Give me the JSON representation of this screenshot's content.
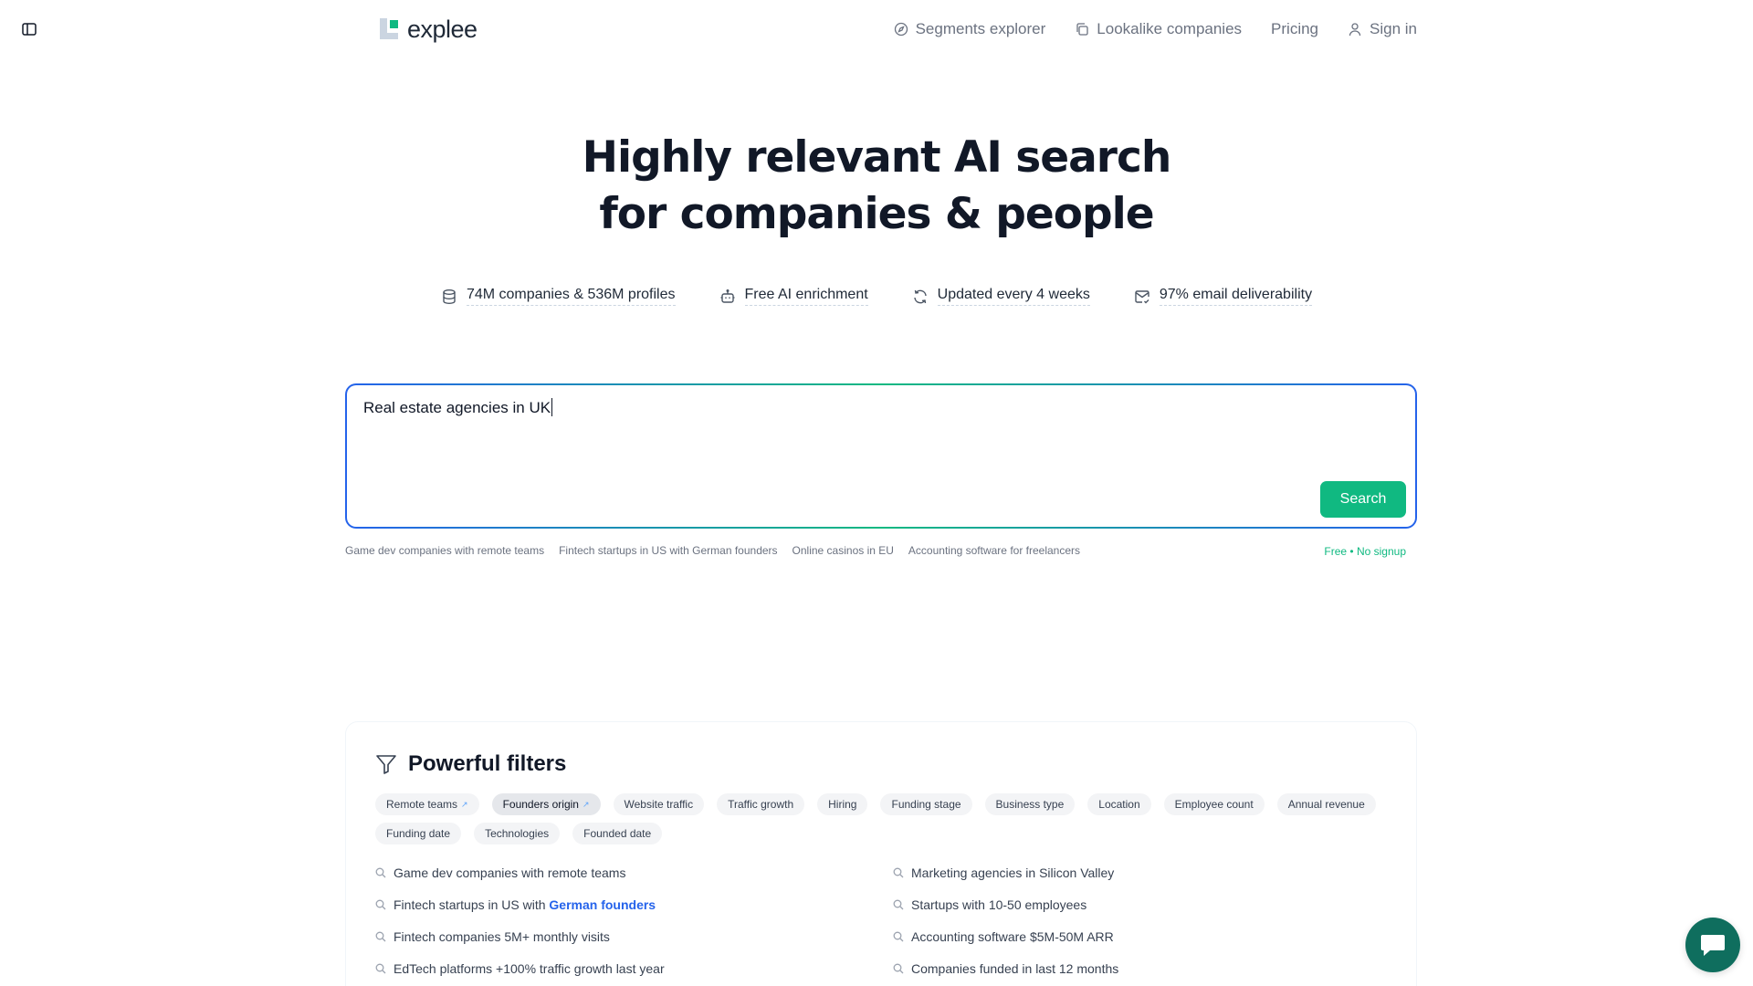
{
  "header": {
    "logo_text": "explee",
    "nav": [
      {
        "label": "Segments explorer",
        "icon": "compass-icon"
      },
      {
        "label": "Lookalike companies",
        "icon": "copy-icon"
      },
      {
        "label": "Pricing",
        "icon": ""
      },
      {
        "label": "Sign in",
        "icon": "user-icon"
      }
    ]
  },
  "hero": {
    "title_line1": "Highly relevant AI search",
    "title_line2": "for companies & people"
  },
  "features": [
    {
      "label": "74M companies & 536M profiles",
      "icon": "database-icon"
    },
    {
      "label": "Free AI enrichment",
      "icon": "bot-icon"
    },
    {
      "label": "Updated every 4 weeks",
      "icon": "refresh-icon"
    },
    {
      "label": "97% email deliverability",
      "icon": "mail-check-icon"
    }
  ],
  "search": {
    "value": "Real estate agencies in UK",
    "button_label": "Search",
    "suggestions": [
      "Game dev companies with remote teams",
      "Fintech startups in US with German founders",
      "Online casinos in EU",
      "Accounting software for freelancers"
    ],
    "free_note": "Free • No signup"
  },
  "filters": {
    "title": "Powerful filters",
    "chips": [
      {
        "label": "Remote teams",
        "external": true,
        "active": false
      },
      {
        "label": "Founders origin",
        "external": true,
        "active": true
      },
      {
        "label": "Website traffic",
        "external": false,
        "active": false
      },
      {
        "label": "Traffic growth",
        "external": false,
        "active": false
      },
      {
        "label": "Hiring",
        "external": false,
        "active": false
      },
      {
        "label": "Funding stage",
        "external": false,
        "active": false
      },
      {
        "label": "Business type",
        "external": false,
        "active": false
      },
      {
        "label": "Location",
        "external": false,
        "active": false
      },
      {
        "label": "Employee count",
        "external": false,
        "active": false
      },
      {
        "label": "Annual revenue",
        "external": false,
        "active": false
      },
      {
        "label": "Funding date",
        "external": false,
        "active": false
      },
      {
        "label": "Technologies",
        "external": false,
        "active": false
      },
      {
        "label": "Founded date",
        "external": false,
        "active": false
      }
    ],
    "examples_left": [
      {
        "text": "Game dev companies with remote teams",
        "highlight": ""
      },
      {
        "text": "Fintech startups in US with ",
        "highlight": "German founders"
      },
      {
        "text": "Fintech companies 5M+ monthly visits",
        "highlight": ""
      },
      {
        "text": "EdTech platforms +100% traffic growth last year",
        "highlight": ""
      }
    ],
    "examples_right": [
      {
        "text": "Marketing agencies in Silicon Valley",
        "highlight": ""
      },
      {
        "text": "Startups with 10-50 employees",
        "highlight": ""
      },
      {
        "text": "Accounting software $5M-50M ARR",
        "highlight": ""
      },
      {
        "text": "Companies funded in last 12 months",
        "highlight": ""
      }
    ]
  },
  "colors": {
    "accent": "#10b981",
    "link": "#2563eb",
    "chat": "#0f6e5e"
  }
}
